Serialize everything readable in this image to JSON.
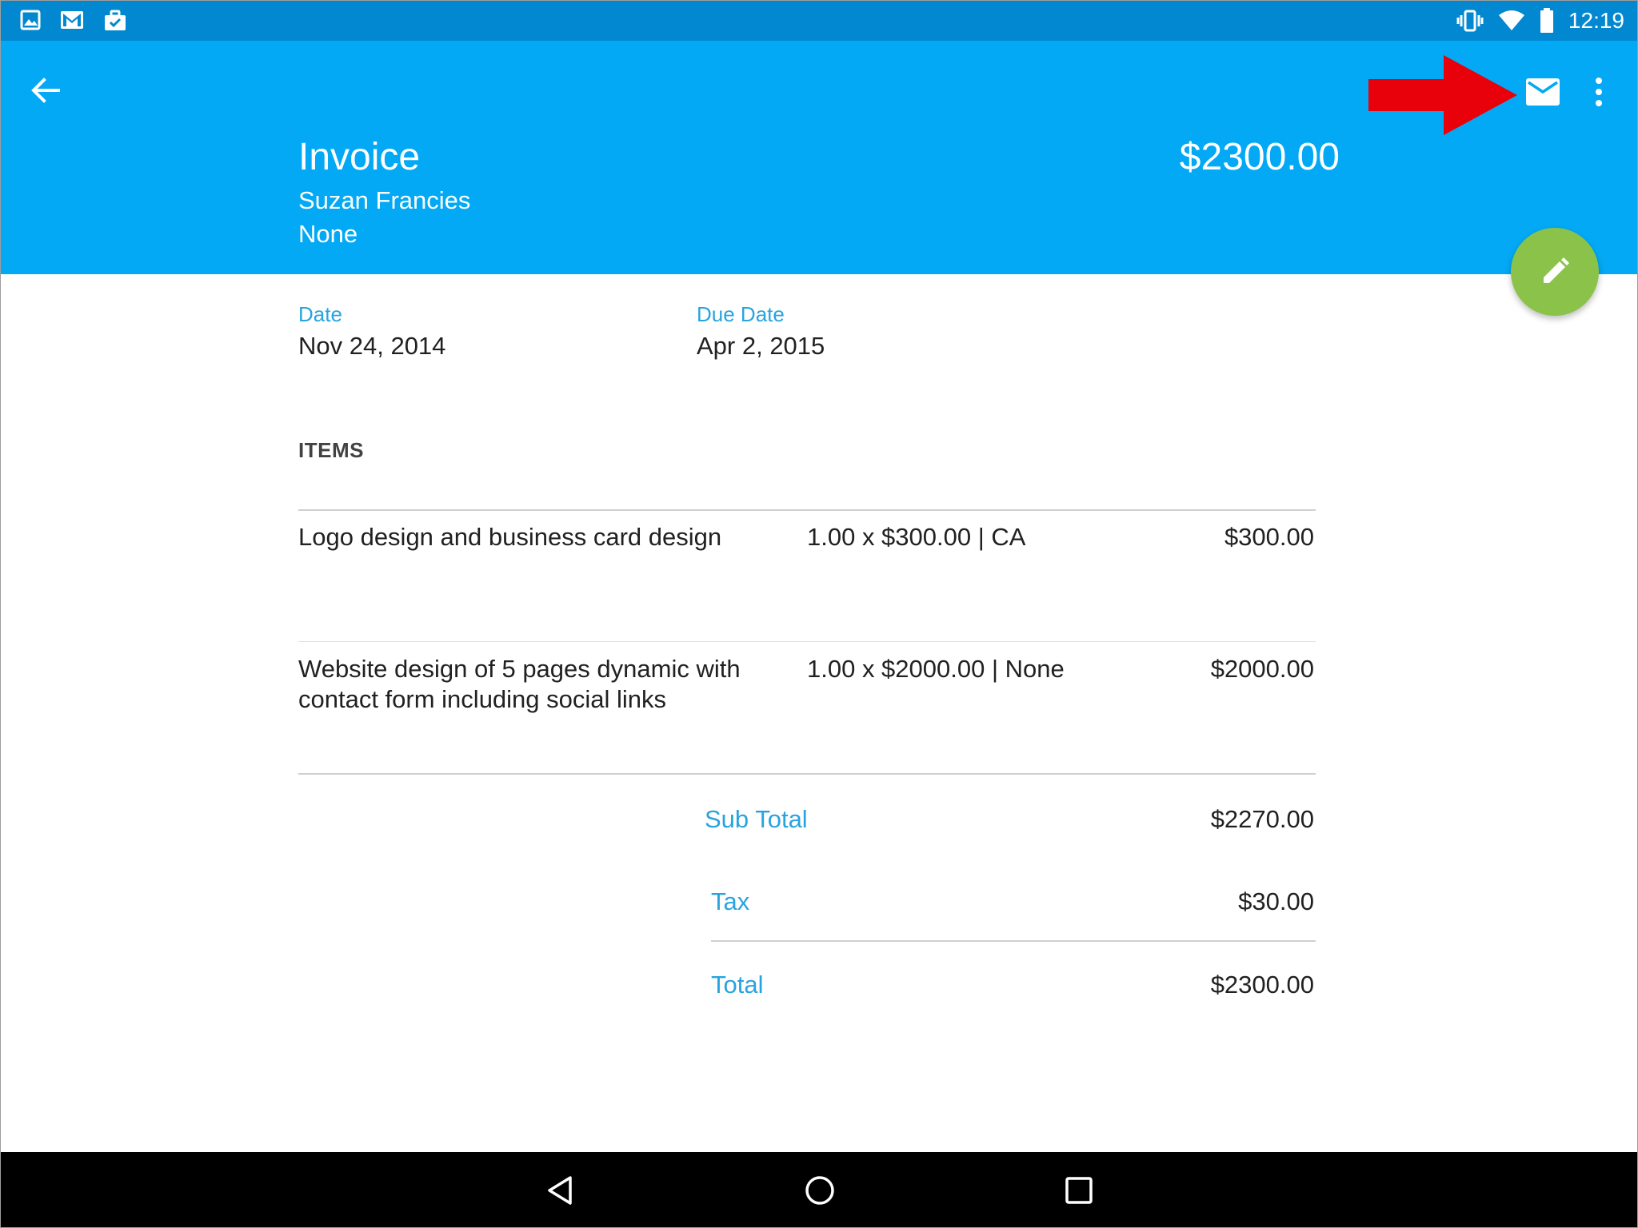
{
  "status_bar": {
    "time": "12:19",
    "left_icons": [
      "image-icon",
      "gmail-icon",
      "briefcase-check-icon"
    ],
    "right_icons": [
      "vibrate-icon",
      "wifi-icon",
      "battery-icon"
    ]
  },
  "header": {
    "title": "Invoice",
    "client": "Suzan Francies",
    "project": "None",
    "amount": "$2300.00",
    "background_color": "#03a9f4",
    "status_color": "#0288d1"
  },
  "dates": {
    "date_label": "Date",
    "date_value": "Nov 24, 2014",
    "due_label": "Due Date",
    "due_value": "Apr 2, 2015"
  },
  "items": {
    "header": "ITEMS",
    "rows": [
      {
        "description": "Logo design and business card design",
        "quantity": "1.00 x $300.00 | CA",
        "amount": "$300.00"
      },
      {
        "description": "Website design of 5 pages dynamic with contact form including social links",
        "quantity": "1.00 x $2000.00 | None",
        "amount": "$2000.00"
      }
    ]
  },
  "summary": {
    "subtotal_label": "Sub Total",
    "subtotal_value": "$2270.00",
    "tax_label": "Tax",
    "tax_value": "$30.00",
    "total_label": "Total",
    "total_value": "$2300.00"
  },
  "colors": {
    "accent": "#29a3e0",
    "fab": "#8bc34a",
    "annotation_arrow": "#e8000b"
  }
}
